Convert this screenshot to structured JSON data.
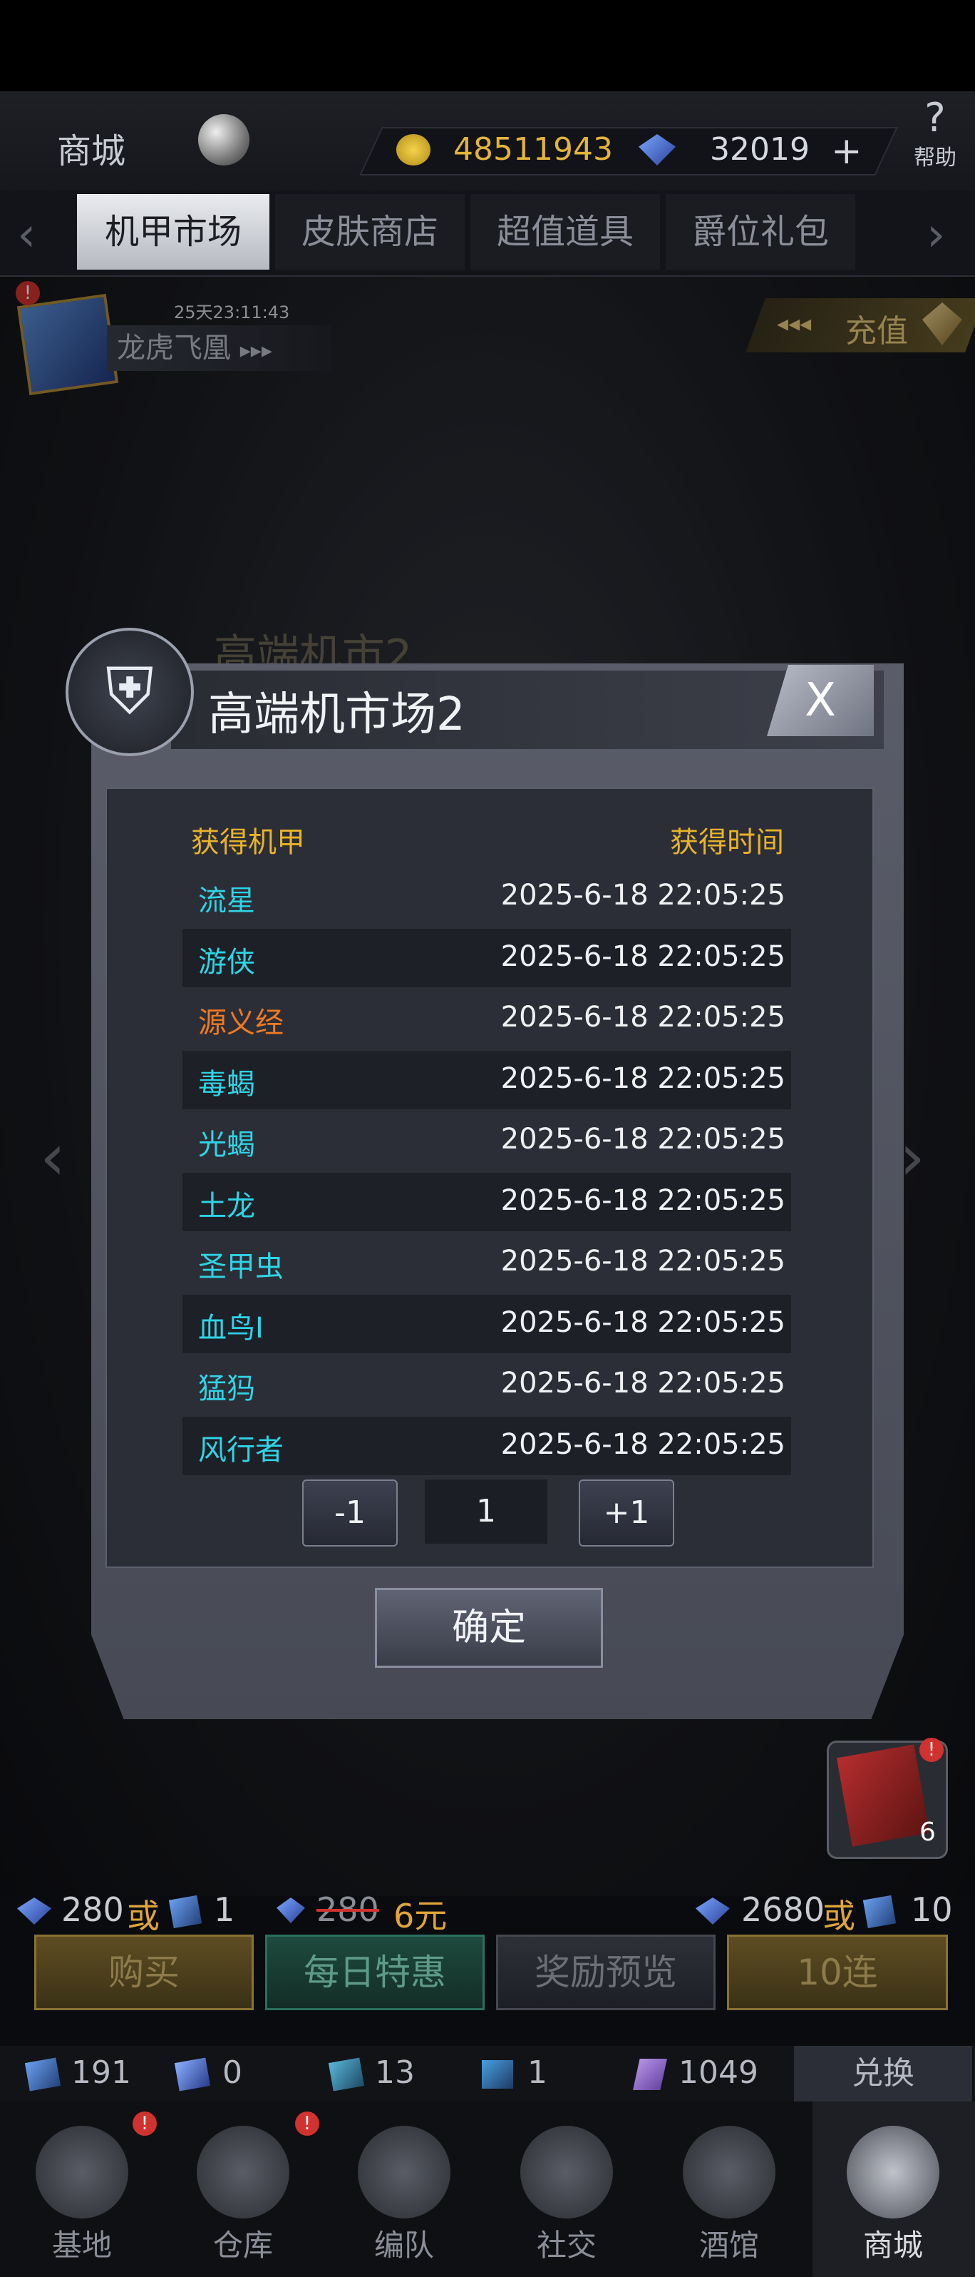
{
  "top": {
    "title": "商城",
    "gold": "48511943",
    "gems": "32019",
    "plus": "+",
    "help_label": "帮助"
  },
  "tabs": [
    {
      "label": "机甲市场",
      "active": true
    },
    {
      "label": "皮肤商店",
      "active": false
    },
    {
      "label": "超值道具",
      "active": false
    },
    {
      "label": "爵位礼包",
      "active": false
    }
  ],
  "banner": {
    "timer": "25天23:11:43",
    "name": "龙虎飞凰",
    "arrows": "▸▸▸"
  },
  "charge": {
    "label": "充值",
    "arrows": "◂◂◂"
  },
  "background_title": "高端机市2",
  "modal": {
    "title": "高端机市场2",
    "close": "X",
    "col_mech": "获得机甲",
    "col_time": "获得时间",
    "rows": [
      {
        "name": "流星",
        "time": "2025-6-18 22:05:25",
        "color": "#2fd4e6"
      },
      {
        "name": "游侠",
        "time": "2025-6-18 22:05:25",
        "color": "#2fd4e6"
      },
      {
        "name": "源义经",
        "time": "2025-6-18 22:05:25",
        "color": "#f07a22"
      },
      {
        "name": "毒蝎",
        "time": "2025-6-18 22:05:25",
        "color": "#2fd4e6"
      },
      {
        "name": "光蝎",
        "time": "2025-6-18 22:05:25",
        "color": "#2fd4e6"
      },
      {
        "name": "土龙",
        "time": "2025-6-18 22:05:25",
        "color": "#2fd4e6"
      },
      {
        "name": "圣甲虫",
        "time": "2025-6-18 22:05:25",
        "color": "#2fd4e6"
      },
      {
        "name": "血鸟I",
        "time": "2025-6-18 22:05:25",
        "color": "#2fd4e6"
      },
      {
        "name": "猛犸",
        "time": "2025-6-18 22:05:25",
        "color": "#2fd4e6"
      },
      {
        "name": "风行者",
        "time": "2025-6-18 22:05:25",
        "color": "#2fd4e6"
      }
    ],
    "minus": "-1",
    "page": "1",
    "plus": "+1",
    "confirm": "确定"
  },
  "side_item_count": "6",
  "prices": {
    "left_gem": "280",
    "or1": "或",
    "left_ticket": "1",
    "old_price": "280",
    "new_price": "6元",
    "right_gem": "2680",
    "or2": "或",
    "right_ticket": "10"
  },
  "actions": {
    "buy": "购买",
    "daily": "每日特惠",
    "preview": "奖励预览",
    "ten": "10连"
  },
  "resources": [
    "191",
    "0",
    "13",
    "1",
    "1049"
  ],
  "exchange": "兑换",
  "nav": [
    {
      "label": "基地",
      "badge": true
    },
    {
      "label": "仓库",
      "badge": true
    },
    {
      "label": "编队",
      "badge": false
    },
    {
      "label": "社交",
      "badge": false
    },
    {
      "label": "酒馆",
      "badge": false
    },
    {
      "label": "商城",
      "badge": false,
      "selected": true
    }
  ],
  "badge_mark": "!"
}
